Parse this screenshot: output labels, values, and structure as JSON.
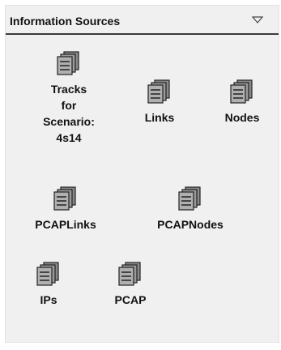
{
  "panel": {
    "title": "Information Sources"
  },
  "sources": {
    "tracks": {
      "label": "Tracks\nfor\nScenario:\n4s14",
      "icon": "database-icon"
    },
    "links": {
      "label": "Links",
      "icon": "database-icon"
    },
    "nodes": {
      "label": "Nodes",
      "icon": "database-icon"
    },
    "pcaplinks": {
      "label": "PCAPLinks",
      "icon": "database-icon"
    },
    "pcapnodes": {
      "label": "PCAPNodes",
      "icon": "database-icon"
    },
    "ips": {
      "label": "IPs",
      "icon": "database-icon"
    },
    "pcap": {
      "label": "PCAP",
      "icon": "database-icon"
    }
  }
}
